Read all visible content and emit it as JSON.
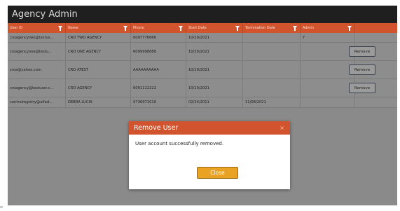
{
  "app": {
    "title": "Agency Admin"
  },
  "colors": {
    "accent": "#d2542e",
    "title_bar": "#1f1f1f",
    "overlay_gray": "#8a8a8a",
    "ok_button": "#e9a224"
  },
  "table": {
    "columns": [
      {
        "label": "User ID",
        "filter_icon": "filter-icon"
      },
      {
        "label": "Name",
        "filter_icon": "filter-icon"
      },
      {
        "label": "Phone",
        "filter_icon": "filter-icon"
      },
      {
        "label": "Start Date",
        "filter_icon": "filter-icon"
      },
      {
        "label": "Termination Date",
        "filter_icon": "filter-icon"
      },
      {
        "label": "Admin",
        "filter_icon": "filter-icon"
      }
    ],
    "rows": [
      {
        "user_id": "croagencytwo@testus...",
        "name": "CRO TWO AGENCY",
        "phone": "6097776666",
        "start_date": "10/20/2021",
        "termination_date": "",
        "admin": "Y",
        "action": ""
      },
      {
        "user_id": "croagencyone@testu...",
        "name": "CRO ONE AGENCY",
        "phone": "6099998888",
        "start_date": "10/20/2021",
        "termination_date": "",
        "admin": "",
        "action": "Remove"
      },
      {
        "user_id": "croa@yahoo.com",
        "name": "CRO ATEST",
        "phone": "AAAAAAAAAA",
        "start_date": "10/19/2021",
        "termination_date": "",
        "admin": "",
        "action": "Remove"
      },
      {
        "user_id": "croagency@testuser.c...",
        "name": "CRO AGENCY",
        "phone": "6091112222",
        "start_date": "10/19/2021",
        "termination_date": "",
        "admin": "",
        "action": "Remove"
      },
      {
        "user_id": "centralregistry@alfad...",
        "name": "DEBRA LUCIA",
        "phone": "9736971010",
        "start_date": "02/24/2011",
        "termination_date": "11/08/2021",
        "admin": "",
        "action": ""
      }
    ]
  },
  "modal": {
    "title": "Remove User",
    "close_glyph": "×",
    "message": "User account successfully removed.",
    "ok_label": "Close"
  }
}
